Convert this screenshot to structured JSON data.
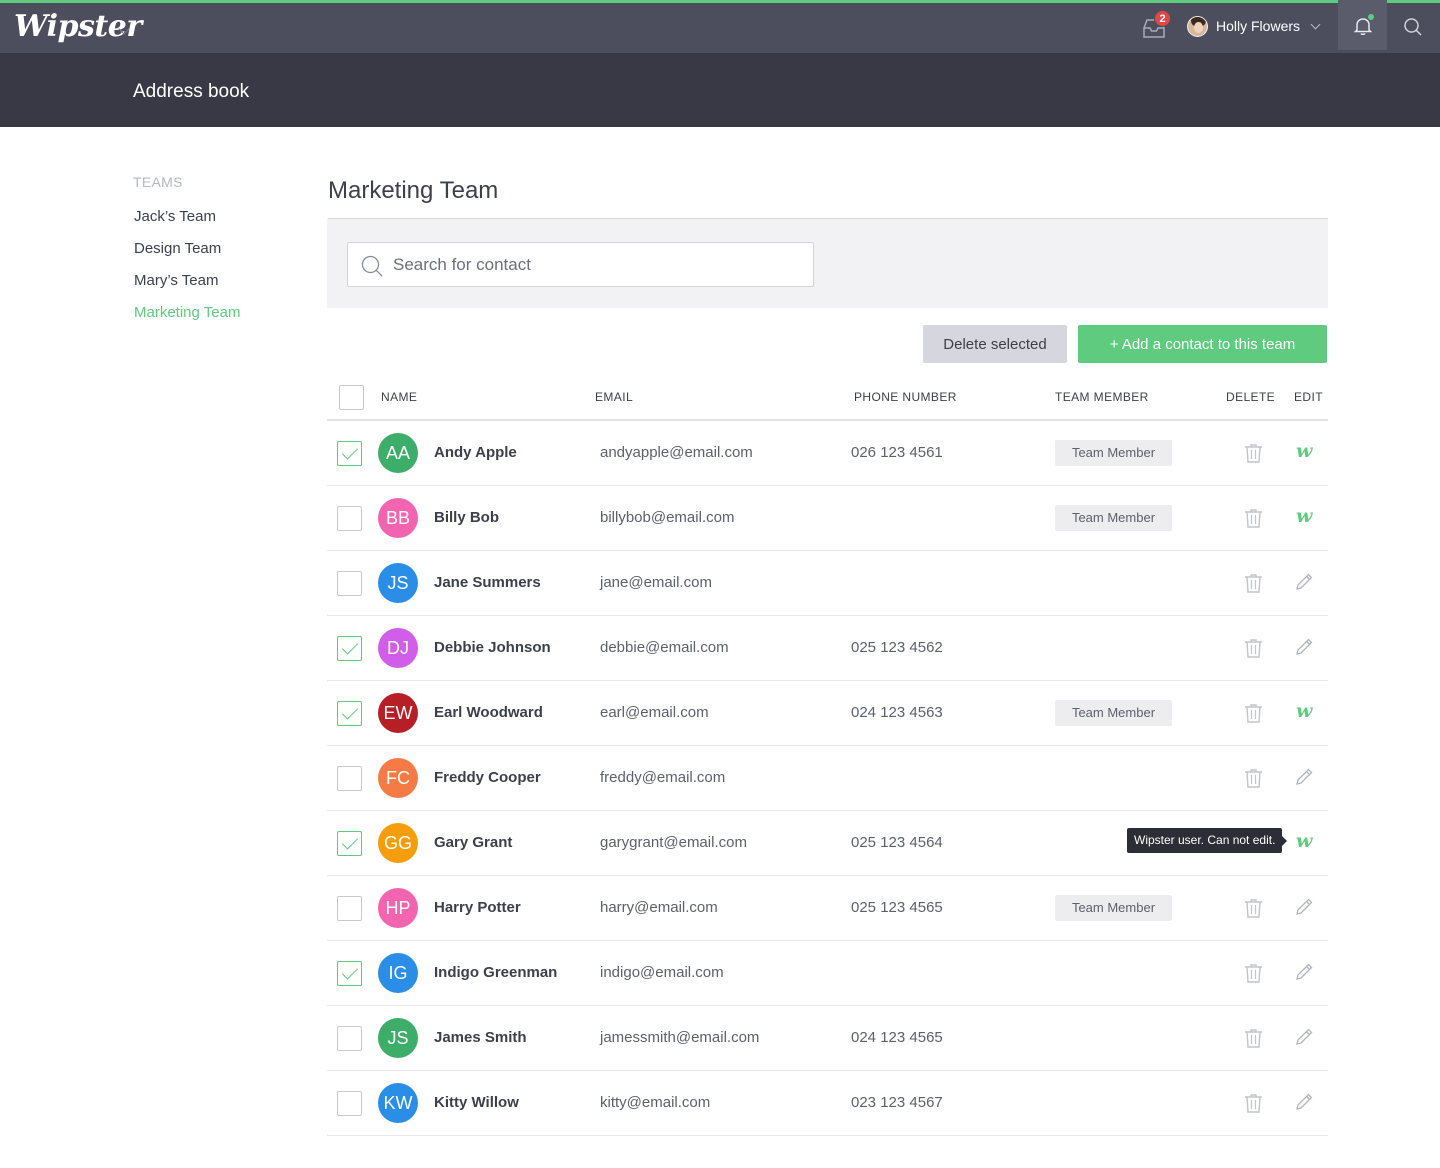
{
  "app": {
    "logo": "Wipster",
    "inbox_badge": "2",
    "user_name": "Holly Flowers"
  },
  "header": {
    "title": "Address book"
  },
  "sidebar": {
    "section_label": "TEAMS",
    "teams": [
      {
        "label": "Jack’s Team",
        "active": false
      },
      {
        "label": "Design Team",
        "active": false
      },
      {
        "label": "Mary’s Team",
        "active": false
      },
      {
        "label": "Marketing Team",
        "active": true
      }
    ]
  },
  "main": {
    "title": "Marketing Team",
    "search_placeholder": "Search for contact",
    "delete_selected_label": "Delete selected",
    "add_contact_label": "+ Add a contact to this team",
    "columns": {
      "name": "NAME",
      "email": "EMAIL",
      "phone": "PHONE NUMBER",
      "team_member": "TEAM MEMBER",
      "delete": "DELETE",
      "edit": "EDIT"
    },
    "tooltip": "Wipster user. Can not edit.",
    "contacts": [
      {
        "initials": "AA",
        "name": "Andy Apple",
        "email": "andyapple@email.com",
        "phone": "026 123 4561",
        "team_member": "Team Member",
        "checked": true,
        "wipster_user": true,
        "color": "#3dae6a"
      },
      {
        "initials": "BB",
        "name": "Billy Bob",
        "email": "billybob@email.com",
        "phone": "",
        "team_member": "Team Member",
        "checked": false,
        "wipster_user": true,
        "color": "#f264b0"
      },
      {
        "initials": "JS",
        "name": "Jane Summers",
        "email": "jane@email.com",
        "phone": "",
        "team_member": "",
        "checked": false,
        "wipster_user": false,
        "color": "#2a8de6"
      },
      {
        "initials": "DJ",
        "name": "Debbie Johnson",
        "email": "debbie@email.com",
        "phone": "025 123 4562",
        "team_member": "",
        "checked": true,
        "wipster_user": false,
        "color": "#d05ee8"
      },
      {
        "initials": "EW",
        "name": "Earl Woodward",
        "email": "earl@email.com",
        "phone": "024 123 4563",
        "team_member": "Team Member",
        "checked": true,
        "wipster_user": true,
        "color": "#b71f27"
      },
      {
        "initials": "FC",
        "name": "Freddy Cooper",
        "email": "freddy@email.com",
        "phone": "",
        "team_member": "",
        "checked": false,
        "wipster_user": false,
        "color": "#f47b45"
      },
      {
        "initials": "GG",
        "name": "Gary Grant",
        "email": "garygrant@email.com",
        "phone": "025 123 4564",
        "team_member": "",
        "checked": true,
        "wipster_user": true,
        "color": "#f59d0b"
      },
      {
        "initials": "HP",
        "name": "Harry Potter",
        "email": "harry@email.com",
        "phone": "025 123 4565",
        "team_member": "Team Member",
        "checked": false,
        "wipster_user": false,
        "color": "#f264b0"
      },
      {
        "initials": "IG",
        "name": "Indigo Greenman",
        "email": "indigo@email.com",
        "phone": "",
        "team_member": "",
        "checked": true,
        "wipster_user": false,
        "color": "#2a8de6"
      },
      {
        "initials": "JS",
        "name": "James Smith",
        "email": "jamessmith@email.com",
        "phone": "024 123 4565",
        "team_member": "",
        "checked": false,
        "wipster_user": false,
        "color": "#3dae6a"
      },
      {
        "initials": "KW",
        "name": "Kitty Willow",
        "email": "kitty@email.com",
        "phone": "023 123 4567",
        "team_member": "",
        "checked": false,
        "wipster_user": false,
        "color": "#2a8de6"
      }
    ]
  },
  "colors": {
    "accent": "#5ecb7e",
    "topbar": "#4c4e5d",
    "header": "#383944",
    "badge": "#e64545"
  }
}
